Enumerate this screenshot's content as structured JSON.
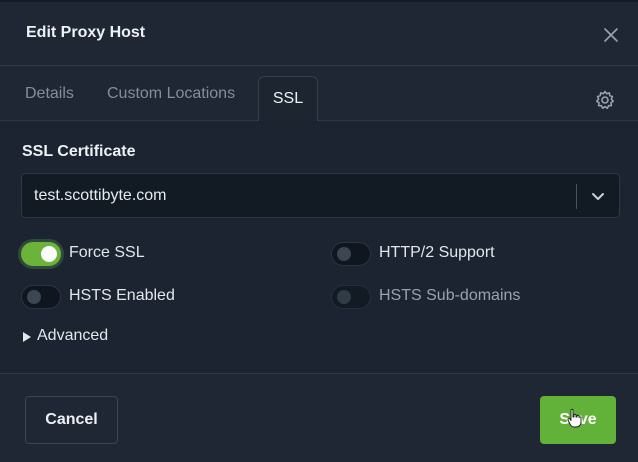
{
  "dialog": {
    "title": "Edit Proxy Host"
  },
  "tabs": [
    {
      "label": "Details",
      "active": false
    },
    {
      "label": "Custom Locations",
      "active": false
    },
    {
      "label": "SSL",
      "active": true
    }
  ],
  "ssl": {
    "section_label": "SSL Certificate",
    "certificate_value": "test.scottibyte.com",
    "toggles": [
      {
        "label": "Force SSL",
        "on": true,
        "disabled": false
      },
      {
        "label": "HTTP/2 Support",
        "on": false,
        "disabled": false
      },
      {
        "label": "HSTS Enabled",
        "on": false,
        "disabled": false
      },
      {
        "label": "HSTS Sub-domains",
        "on": false,
        "disabled": true
      }
    ],
    "advanced_label": "Advanced"
  },
  "footer": {
    "cancel_label": "Cancel",
    "save_label": "Save"
  },
  "colors": {
    "accent": "#62b23a",
    "background": "#1e2733"
  },
  "icons": {
    "close": "close-icon",
    "settings": "gear-icon",
    "select": "chevron-down-icon",
    "expand": "caret-right-icon"
  }
}
